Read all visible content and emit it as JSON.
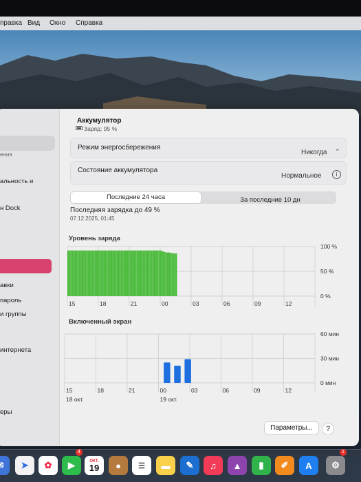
{
  "menubar": {
    "items": [
      "правка",
      "Вид",
      "Окно",
      "Справка"
    ]
  },
  "sidebar": {
    "items": [
      "ения",
      "альность и",
      "н Dock",
      "авки",
      "пароль",
      "и группы",
      "интернета",
      "еры"
    ]
  },
  "header": {
    "title": "Аккумулятор",
    "charge": "Заряд: 95 %"
  },
  "settings": {
    "power_saving_label": "Режим энергосбережения",
    "power_saving_value": "Никогда",
    "battery_state_label": "Состояние аккумулятора",
    "battery_state_value": "Нормальное"
  },
  "tabs": {
    "last24": "Последние 24 часа",
    "last10": "За последние 10 дн"
  },
  "last_charge": {
    "text": "Последняя зарядка до 49 %",
    "date": "07.12.2025, 01:45"
  },
  "footer": {
    "params_button": "Параметры...",
    "help_button": "?"
  },
  "dock": {
    "facetime_badge": "4",
    "calendar_month": "ОКТ.",
    "calendar_day": "19",
    "appstore_badge": "1"
  },
  "colors": {
    "battery_bar": "#4cbb3c",
    "screen_bar": "#1d6fe0",
    "pink_selection": "#d6416e"
  },
  "chart_data": [
    {
      "type": "bar",
      "title": "Уровень заряда",
      "x_ticks": [
        "15",
        "18",
        "21",
        "00",
        "03",
        "06",
        "09",
        "12"
      ],
      "y_ticks": [
        "100 %",
        "50 %",
        "0 %"
      ],
      "ylim": [
        0,
        100
      ],
      "series": [
        {
          "values": [
            92,
            92,
            92,
            92,
            92,
            92,
            92,
            92,
            92,
            92,
            92,
            92,
            92,
            92,
            92,
            92,
            92,
            92,
            92,
            92,
            92,
            92,
            92,
            92,
            92,
            92,
            92,
            92,
            92,
            92,
            92,
            92,
            92,
            92,
            92,
            92,
            92,
            92,
            92,
            92,
            92,
            92,
            92,
            92,
            92,
            92,
            92,
            92,
            92,
            92,
            92,
            92,
            92,
            92,
            92,
            92,
            92,
            92,
            92,
            92,
            92,
            92,
            92,
            92,
            92,
            91,
            90,
            89,
            88,
            88,
            88,
            87,
            87,
            86,
            86,
            86
          ]
        }
      ],
      "grid": true
    },
    {
      "type": "bar",
      "title": "Включенный экран",
      "x_ticks": [
        "15",
        "18",
        "21",
        "00",
        "03",
        "06",
        "09",
        "12"
      ],
      "x_subticks": [
        "18 окт.",
        "",
        "",
        "19 окт.",
        "",
        "",
        "",
        ""
      ],
      "y_ticks": [
        "60 мин",
        "30 мин",
        "0 мин"
      ],
      "ylim": [
        0,
        60
      ],
      "series": [
        {
          "values": [
            0,
            0,
            0,
            0,
            0,
            0,
            0,
            0,
            0,
            0,
            0,
            0,
            0,
            0,
            0,
            0,
            0,
            0,
            0,
            25,
            0,
            21,
            0,
            29,
            0,
            0,
            0,
            0,
            0,
            0,
            0,
            0,
            0,
            0,
            0,
            0,
            0,
            0,
            0,
            0,
            0,
            0,
            0,
            0,
            0,
            0,
            0,
            0
          ]
        }
      ],
      "grid": true
    }
  ]
}
